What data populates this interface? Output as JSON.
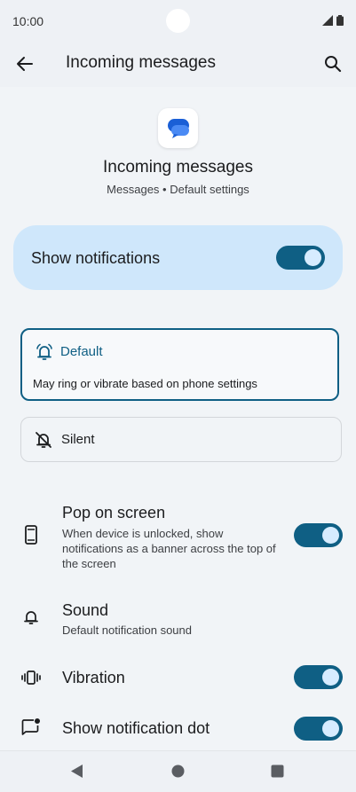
{
  "status": {
    "time": "10:00"
  },
  "app_bar": {
    "title": "Incoming messages"
  },
  "header": {
    "title": "Incoming messages",
    "subtitle": "Messages • Default settings"
  },
  "show_notifications": {
    "label": "Show notifications",
    "enabled": true
  },
  "options": {
    "default": {
      "label": "Default",
      "description": "May ring or vibrate based on phone settings",
      "selected": true
    },
    "silent": {
      "label": "Silent",
      "selected": false
    }
  },
  "settings": {
    "pop_on_screen": {
      "title": "Pop on screen",
      "description": "When device is unlocked, show notifications as a banner across the top of the screen",
      "enabled": true
    },
    "sound": {
      "title": "Sound",
      "description": "Default notification sound"
    },
    "vibration": {
      "title": "Vibration",
      "enabled": true
    },
    "notification_dot": {
      "title": "Show notification dot",
      "enabled": true
    }
  },
  "colors": {
    "accent": "#0f5f84",
    "highlight": "#cfe7fb",
    "background": "#f1f4f7"
  },
  "icons": [
    "back-arrow-icon",
    "search-icon",
    "messages-app-icon",
    "bell-icon",
    "bell-off-icon",
    "phone-icon",
    "vibration-icon",
    "notification-dot-icon"
  ]
}
